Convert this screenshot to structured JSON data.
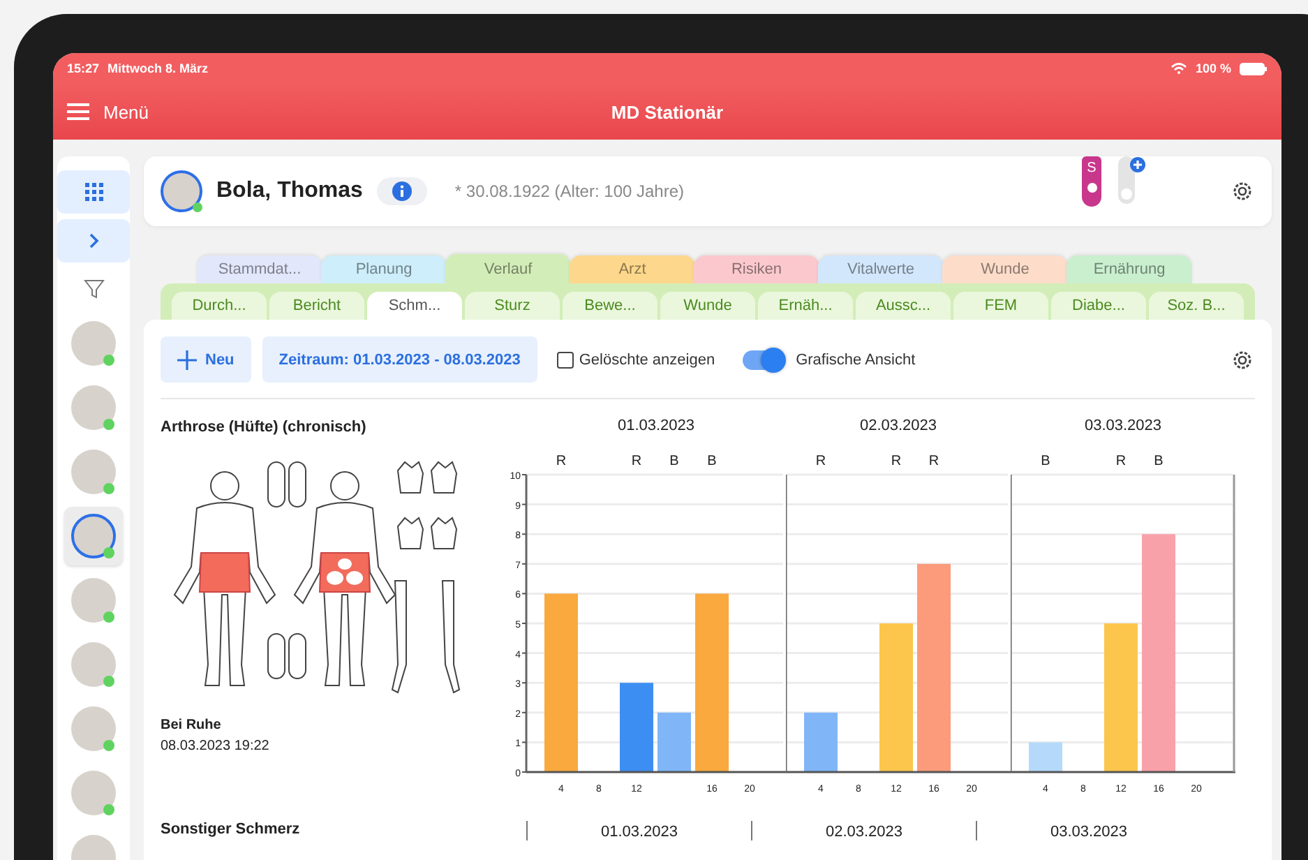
{
  "status_bar": {
    "time": "15:27",
    "date": "Mittwoch 8. März",
    "battery": "100 %"
  },
  "header": {
    "menu_label": "Menü",
    "title": "MD Stationär"
  },
  "sidebar": {
    "residents": [
      {
        "selected": false
      },
      {
        "selected": false
      },
      {
        "selected": false
      },
      {
        "selected": true
      },
      {
        "selected": false
      },
      {
        "selected": false
      },
      {
        "selected": false
      },
      {
        "selected": false
      },
      {
        "selected": false
      }
    ]
  },
  "patient": {
    "name": "Bola, Thomas",
    "birth": "* 30.08.1922 (Alter: 100 Jahre)",
    "tag": "S"
  },
  "category_tabs": [
    {
      "label": "Stammdat...",
      "color": "#e3e7fb",
      "selected": false
    },
    {
      "label": "Planung",
      "color": "#cdeefa",
      "selected": false
    },
    {
      "label": "Verlauf",
      "color": "#d3edb8",
      "selected": true
    },
    {
      "label": "Arzt",
      "color": "#fdd88c",
      "selected": false
    },
    {
      "label": "Risiken",
      "color": "#fbc9cd",
      "selected": false
    },
    {
      "label": "Vitalwerte",
      "color": "#d2e7fb",
      "selected": false
    },
    {
      "label": "Wunde",
      "color": "#fddcca",
      "selected": false
    },
    {
      "label": "Ernährung",
      "color": "#c9efcf",
      "selected": false
    }
  ],
  "sub_tabs": [
    {
      "label": "Durch...",
      "selected": false
    },
    {
      "label": "Bericht",
      "selected": false
    },
    {
      "label": "Schm...",
      "selected": true
    },
    {
      "label": "Sturz",
      "selected": false
    },
    {
      "label": "Bewe...",
      "selected": false
    },
    {
      "label": "Wunde",
      "selected": false
    },
    {
      "label": "Ernäh...",
      "selected": false
    },
    {
      "label": "Aussc...",
      "selected": false
    },
    {
      "label": "FEM",
      "selected": false
    },
    {
      "label": "Diabe...",
      "selected": false
    },
    {
      "label": "Soz. B...",
      "selected": false
    }
  ],
  "toolbar": {
    "new_button": "Neu",
    "period_button": "Zeitraum: 01.03.2023 - 08.03.2023",
    "show_deleted": {
      "label": "Gelöschte anzeigen",
      "checked": false
    },
    "graphic_view": {
      "label": "Grafische Ansicht",
      "on": true
    }
  },
  "sections": [
    {
      "title": "Arthrose (Hüfte) (chronisch)",
      "situation": "Bei Ruhe",
      "timestamp": "08.03.2023 19:22",
      "charts": [
        {
          "chart_data": {
            "type": "bar",
            "grid": true,
            "title": "01.03.2023",
            "categories": [
              "4",
              "8",
              "12",
              null,
              "16",
              "20"
            ],
            "ylim": [
              0,
              10
            ],
            "yticks": [
              0,
              1,
              2,
              3,
              4,
              5,
              6,
              7,
              8,
              9,
              10
            ],
            "value_labels": [
              "R",
              null,
              "R",
              "B",
              "B",
              null
            ],
            "series": [
              {
                "color": "#f9a93e",
                "values": [
                  6,
                  null,
                  null,
                  null,
                  6,
                  null
                ]
              },
              {
                "color": "#3d8ef2",
                "values": [
                  null,
                  null,
                  3,
                  null,
                  null,
                  null
                ]
              },
              {
                "color": "#80b6f7",
                "values": [
                  null,
                  null,
                  null,
                  2,
                  null,
                  null
                ]
              }
            ]
          }
        },
        {
          "chart_data": {
            "type": "bar",
            "grid": true,
            "title": "02.03.2023",
            "categories": [
              "4",
              "8",
              "12",
              "16",
              "20"
            ],
            "ylim": [
              0,
              10
            ],
            "value_labels": [
              "R",
              null,
              "R",
              "R",
              null
            ],
            "series": [
              {
                "color": "#80b6f7",
                "values": [
                  2,
                  null,
                  null,
                  null,
                  null
                ]
              },
              {
                "color": "#fcc64c",
                "values": [
                  null,
                  null,
                  5,
                  null,
                  null
                ]
              },
              {
                "color": "#fb9b7b",
                "values": [
                  null,
                  null,
                  null,
                  7,
                  null
                ]
              }
            ]
          }
        },
        {
          "chart_data": {
            "type": "bar",
            "grid": true,
            "title": "03.03.2023",
            "categories": [
              "4",
              "8",
              "12",
              "16",
              "20"
            ],
            "ylim": [
              0,
              10
            ],
            "value_labels": [
              "B",
              null,
              "R",
              "B",
              null
            ],
            "series": [
              {
                "color": "#b4d9fb",
                "values": [
                  1,
                  null,
                  null,
                  null,
                  null
                ]
              },
              {
                "color": "#fcc64c",
                "values": [
                  null,
                  null,
                  5,
                  null,
                  null
                ]
              },
              {
                "color": "#f9a1a9",
                "values": [
                  null,
                  null,
                  null,
                  8,
                  null
                ]
              }
            ]
          }
        }
      ]
    },
    {
      "title": "Sonstiger Schmerz",
      "date_headers": [
        "01.03.2023",
        "02.03.2023",
        "03.03.2023"
      ]
    }
  ]
}
